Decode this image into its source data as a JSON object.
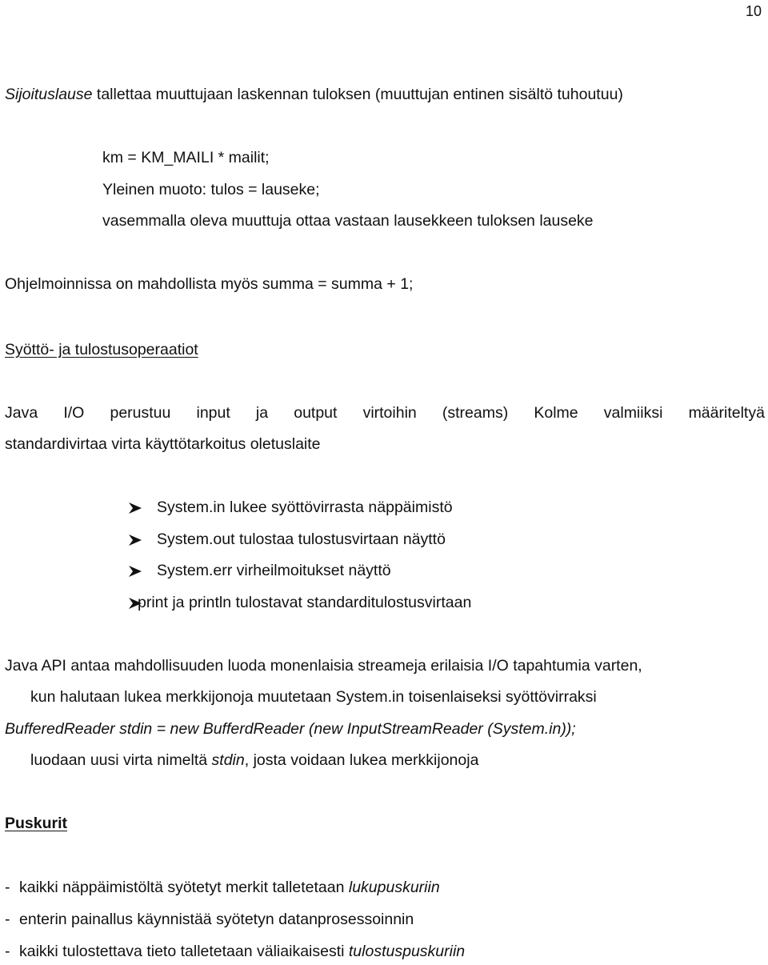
{
  "page_number": "10",
  "intro": {
    "term": "Sijoituslause",
    "rest": " tallettaa muuttujaan laskennan tuloksen (muuttujan entinen sisältö tuhoutuu)"
  },
  "assignment_block": [
    "km = KM_MAILI * mailit;",
    "Yleinen muoto: tulos = lauseke;",
    "vasemmalla oleva muuttuja ottaa vastaan lausekkeen tuloksen lauseke"
  ],
  "summa_line": "Ohjelmoinnissa on mahdollista myös summa = summa + 1;",
  "io_heading": "Syöttö- ja tulostusoperaatiot",
  "io_paragraph": {
    "line1_words": [
      "Java",
      "I/O",
      "perustuu",
      "input",
      "ja",
      "output",
      "virtoihin",
      "(streams)",
      "Kolme",
      "valmiiksi",
      "määriteltyä"
    ],
    "line2": "standardivirtaa virta käyttötarkoitus oletuslaite"
  },
  "stream_bullets": [
    "System.in lukee syöttövirrasta näppäimistö",
    "System.out tulostaa tulostusvirtaan näyttö",
    "System.err virheilmoitukset näyttö",
    "print ja println tulostavat standarditulostusvirtaan"
  ],
  "api_paragraph": {
    "line1": "Java API antaa mahdollisuuden luoda monenlaisia streameja erilaisia I/O tapahtumia varten,",
    "line2": "kun halutaan lukea merkkijonoja muutetaan System.in toisenlaiseksi syöttövirraksi",
    "code_line": "BufferedReader stdin = new BufferdReader (new InputStreamReader (System.in));",
    "line4_before": "luodaan uusi virta nimeltä ",
    "line4_italic": "stdin",
    "line4_after": ", josta voidaan lukea merkkijonoja"
  },
  "buffer_heading": "Puskurit",
  "buffer_items": [
    {
      "text": "kaikki näppäimistöltä syötetyt merkit talletetaan ",
      "italic": "lukupuskuriin"
    },
    {
      "text": "enterin painallus käynnistää syötetyn datanprosessoinnin",
      "italic": ""
    },
    {
      "text": "kaikki tulostettava tieto talletetaan väliaikaisesti ",
      "italic": "tulostuspuskuriin"
    }
  ],
  "dash": "-"
}
